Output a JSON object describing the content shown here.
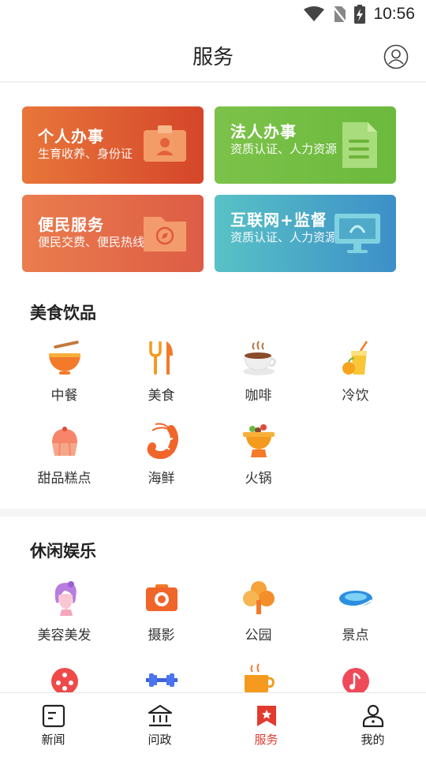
{
  "status_bar": {
    "time": "10:56"
  },
  "header": {
    "title": "服务"
  },
  "service_cards": [
    {
      "title": "个人办事",
      "subtitle": "生育收养、身份证"
    },
    {
      "title": "法人办事",
      "subtitle": "资质认证、人力资源"
    },
    {
      "title": "便民服务",
      "subtitle": "便民交费、便民热线"
    },
    {
      "title": "互联网+监督",
      "subtitle": "资质认证、人力资源"
    }
  ],
  "food": {
    "title": "美食饮品",
    "items": [
      {
        "label": "中餐",
        "icon": "noodle-bowl-icon"
      },
      {
        "label": "美食",
        "icon": "fork-knife-icon"
      },
      {
        "label": "咖啡",
        "icon": "coffee-cup-icon"
      },
      {
        "label": "冷饮",
        "icon": "juice-icon"
      },
      {
        "label": "甜品糕点",
        "icon": "cake-icon"
      },
      {
        "label": "海鲜",
        "icon": "shrimp-icon"
      },
      {
        "label": "火锅",
        "icon": "hotpot-icon"
      }
    ]
  },
  "leisure": {
    "title": "休闲娱乐",
    "items": [
      {
        "label": "美容美发",
        "icon": "beauty-icon"
      },
      {
        "label": "摄影",
        "icon": "camera-icon"
      },
      {
        "label": "公园",
        "icon": "tree-icon"
      },
      {
        "label": "景点",
        "icon": "scenic-icon"
      },
      {
        "label": "",
        "icon": "game-icon"
      },
      {
        "label": "",
        "icon": "dumbbell-icon"
      },
      {
        "label": "",
        "icon": "tea-icon"
      },
      {
        "label": "",
        "icon": "music-icon"
      }
    ]
  },
  "tabbar": {
    "active": "服务",
    "items": [
      {
        "label": "新闻",
        "icon": "news-icon"
      },
      {
        "label": "问政",
        "icon": "government-icon"
      },
      {
        "label": "服务",
        "icon": "service-icon"
      },
      {
        "label": "我的",
        "icon": "profile-icon"
      }
    ]
  },
  "colors": {
    "accent": "#e23b2e",
    "orange": "#f0702b"
  }
}
